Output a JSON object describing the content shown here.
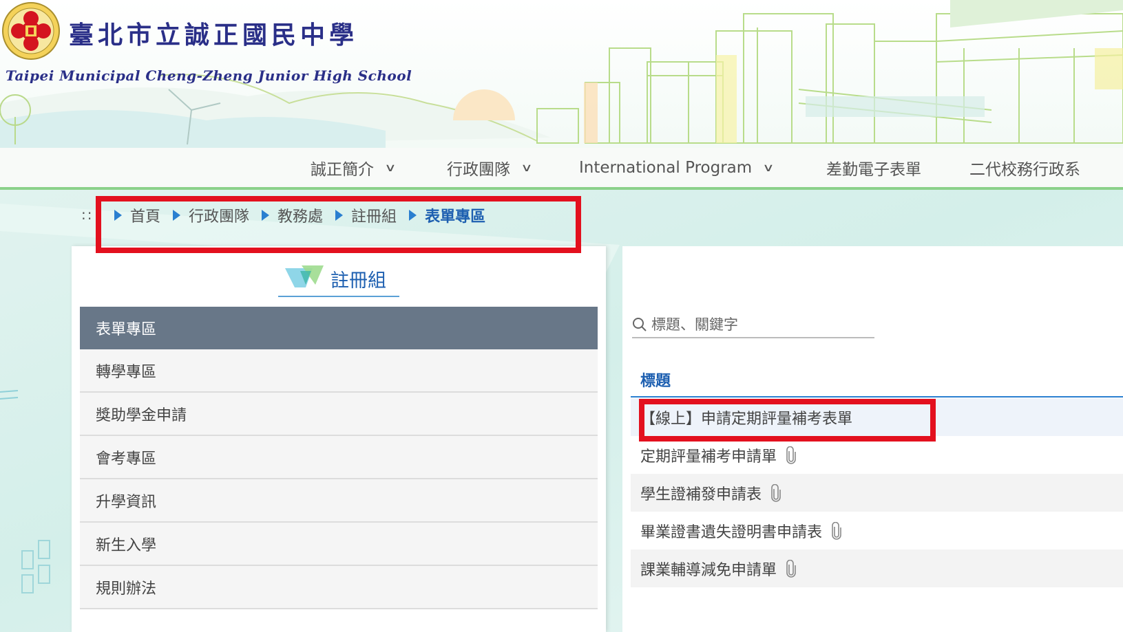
{
  "header": {
    "school_name_zh": "臺北市立誠正國民中學",
    "school_name_en": "Taipei Municipal Cheng-Zheng Junior High School"
  },
  "nav": {
    "items": [
      {
        "label": "誠正簡介",
        "has_dropdown": true
      },
      {
        "label": "行政團隊",
        "has_dropdown": true
      },
      {
        "label": "International Program",
        "has_dropdown": true
      },
      {
        "label": "差勤電子表單",
        "has_dropdown": false
      },
      {
        "label": "二代校務行政系",
        "has_dropdown": false
      }
    ]
  },
  "breadcrumb": {
    "separator": "::",
    "items": [
      "首頁",
      "行政團隊",
      "教務處",
      "註冊組",
      "表單專區"
    ]
  },
  "sidebar": {
    "title": "註冊組",
    "items": [
      {
        "label": "表單專區",
        "active": true
      },
      {
        "label": "轉學專區"
      },
      {
        "label": "獎助學金申請"
      },
      {
        "label": "會考專區"
      },
      {
        "label": "升學資訊"
      },
      {
        "label": "新生入學"
      },
      {
        "label": "規則辦法"
      }
    ]
  },
  "main": {
    "search_placeholder": "標題、關鍵字",
    "table_header": "標題",
    "rows": [
      {
        "title": "【線上】申請定期評量補考表單",
        "attachment": false
      },
      {
        "title": "定期評量補考申請單",
        "attachment": true
      },
      {
        "title": "學生證補發申請表",
        "attachment": true
      },
      {
        "title": "畢業證書遺失證明書申請表",
        "attachment": true
      },
      {
        "title": "課業輔導減免申請單",
        "attachment": true
      }
    ]
  },
  "colors": {
    "brand_navy": "#2a2f88",
    "link_blue": "#1d5fb0",
    "accent_green": "#8bd18a",
    "active_menu": "#687788",
    "annotation_red": "#e3101e"
  },
  "icons": {
    "logo": "school-seal-icon",
    "search": "search-icon",
    "attachment": "paperclip-icon",
    "dropdown": "chevron-down-icon",
    "breadcrumb_marker": "triangle-right-icon"
  }
}
